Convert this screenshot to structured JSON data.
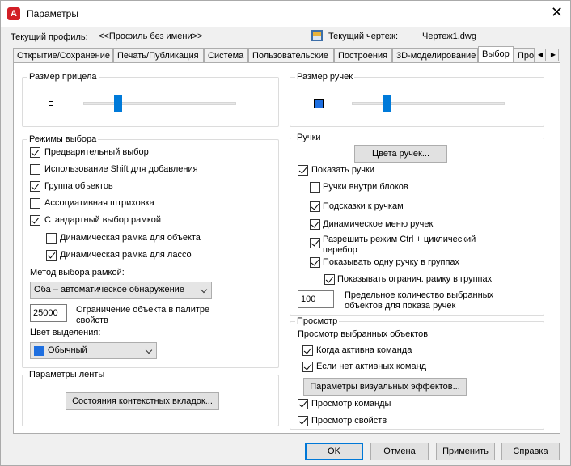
{
  "window": {
    "title": "Параметры",
    "app_icon_letter": "A"
  },
  "header": {
    "profile_label": "Текущий профиль:",
    "profile_value": "<<Профиль без имени>>",
    "drawing_label": "Текущий чертеж:",
    "drawing_value": "Чертеж1.dwg"
  },
  "tabs": [
    {
      "label": "Открытие/Сохранение"
    },
    {
      "label": "Печать/Публикация"
    },
    {
      "label": "Система"
    },
    {
      "label": "Пользовательские"
    },
    {
      "label": "Построения"
    },
    {
      "label": "3D-моделирование"
    },
    {
      "label": "Выбор",
      "active": true
    },
    {
      "label": "Про"
    }
  ],
  "left": {
    "pickbox": {
      "title": "Размер прицела",
      "level": 0.23
    },
    "modes": {
      "title": "Режимы выбора",
      "items": [
        {
          "label": "Предварительный выбор",
          "checked": true
        },
        {
          "label": "Использование Shift для добавления",
          "checked": false
        },
        {
          "label": "Группа объектов",
          "checked": true
        },
        {
          "label": "Ассоциативная штриховка",
          "checked": false
        },
        {
          "label": "Стандартный выбор рамкой",
          "checked": true
        },
        {
          "label": "Динамическая рамка для объекта",
          "checked": false
        },
        {
          "label": "Динамическая рамка для лассо",
          "checked": true
        }
      ],
      "method_label": "Метод выбора рамкой:",
      "method_value": "Оба – автоматическое обнаружение",
      "limit_value": "25000",
      "limit_label_1": "Ограничение объекта в палитре",
      "limit_label_2": "свойств",
      "color_label": "Цвет выделения:",
      "color_value": "Обычный",
      "color_swatch": "#1e6fe0"
    },
    "ribbon": {
      "title": "Параметры ленты",
      "button": "Состояния контекстных вкладок..."
    }
  },
  "right": {
    "gripsize": {
      "title": "Размер ручек",
      "level": 0.23
    },
    "grips": {
      "title": "Ручки",
      "colors_button": "Цвета ручек...",
      "items": [
        {
          "label": "Показать ручки",
          "checked": true
        },
        {
          "label": "Ручки внутри блоков",
          "checked": false
        },
        {
          "label": "Подсказки к ручкам",
          "checked": true
        },
        {
          "label": "Динамическое меню ручек",
          "checked": true
        },
        {
          "label_1": "Разрешить режим Ctrl + циклический",
          "label_2": "перебор",
          "checked": true
        },
        {
          "label": "Показывать одну ручку в группах",
          "checked": true
        },
        {
          "label": "Показывать огранич. рамку в группах",
          "checked": true
        }
      ],
      "limit_value": "100",
      "limit_label_1": "Предельное количество выбранных",
      "limit_label_2": "объектов для показа ручек"
    },
    "preview": {
      "title": "Просмотр",
      "subtitle": "Просмотр выбранных объектов",
      "items": [
        {
          "label": "Когда активна команда",
          "checked": true
        },
        {
          "label": "Если нет активных команд",
          "checked": true
        }
      ],
      "effects_button": "Параметры визуальных эффектов...",
      "cmd_preview": {
        "label": "Просмотр команды",
        "checked": true
      },
      "prop_preview": {
        "label": "Просмотр свойств",
        "checked": true
      }
    }
  },
  "footer": {
    "ok": "OK",
    "cancel": "Отмена",
    "apply": "Применить",
    "help": "Справка"
  },
  "colors": {
    "accent": "#0078d7",
    "slider": "#007ad9",
    "autocad_red": "#d21f26"
  }
}
